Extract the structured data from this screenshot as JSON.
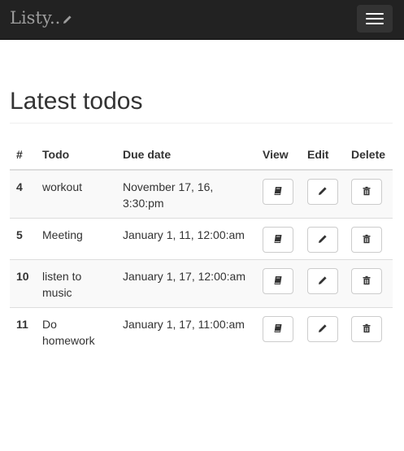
{
  "navbar": {
    "brand": "Listy..",
    "brand_icon": "pencil-icon",
    "toggle_icon": "hamburger-menu-icon"
  },
  "page": {
    "title": "Latest todos"
  },
  "table": {
    "headers": {
      "num": "#",
      "todo": "Todo",
      "due": "Due date",
      "view": "View",
      "edit": "Edit",
      "delete": "Delete"
    },
    "rows": [
      {
        "id": "4",
        "todo": "workout",
        "due": "November 17, 16, 3:30:pm"
      },
      {
        "id": "5",
        "todo": "Meeting",
        "due": "January 1, 11, 12:00:am"
      },
      {
        "id": "10",
        "todo": "listen to music",
        "due": "January 1, 17, 12:00:am"
      },
      {
        "id": "11",
        "todo": "Do homework",
        "due": "January 1, 17, 11:00:am"
      }
    ],
    "action_icons": {
      "view": "book-icon",
      "edit": "pencil-icon",
      "delete": "trash-icon"
    }
  },
  "colors": {
    "navbar_bg": "#222222",
    "brand_text": "#9d9d9d",
    "stripe": "#f9f9f9",
    "border": "#dddddd"
  }
}
